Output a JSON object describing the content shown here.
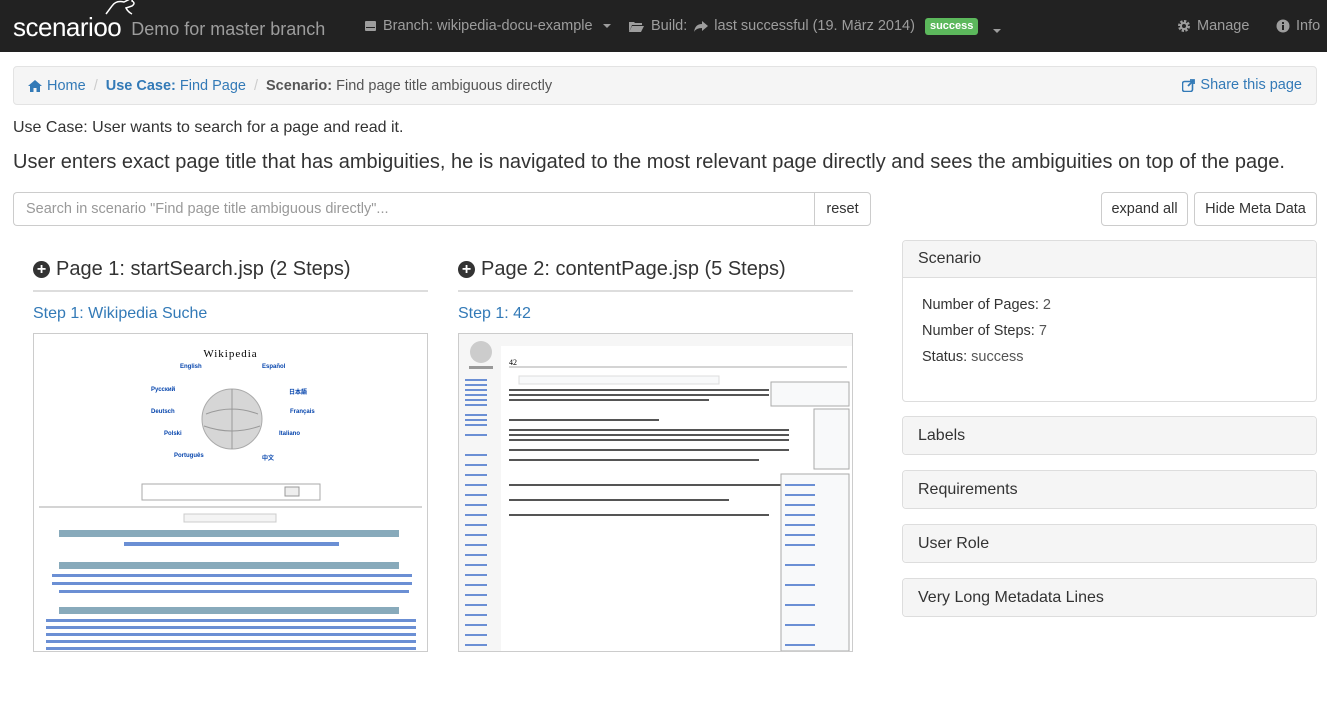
{
  "navbar": {
    "brand": "scenarioo",
    "title": "Demo for master branch",
    "branch_label": "Branch: wikipedia-docu-example",
    "build_label": "Build:",
    "build_value": "last successful (19. März 2014)",
    "build_status": "success",
    "manage": "Manage",
    "info": "Info"
  },
  "breadcrumb": {
    "home": "Home",
    "usecase_prefix": "Use Case:",
    "usecase": "Find Page",
    "scenario_prefix": "Scenario:",
    "scenario": "Find page title ambiguous directly",
    "share": "Share this page"
  },
  "usecase_description": "Use Case: User wants to search for a page and read it.",
  "scenario_description": "User enters exact page title that has ambiguities, he is navigated to the most relevant page directly and sees the ambiguities on top of the page.",
  "search": {
    "placeholder": "Search in scenario \"Find page title ambiguous directly\"...",
    "reset": "reset"
  },
  "buttons": {
    "expand_all": "expand all",
    "hide_meta": "Hide Meta Data"
  },
  "pages": [
    {
      "title": "Page 1: startSearch.jsp (2 Steps)",
      "step": "Step 1: Wikipedia Suche"
    },
    {
      "title": "Page 2: contentPage.jsp (5 Steps)",
      "step": "Step 1: 42"
    }
  ],
  "scenario_panel": {
    "heading": "Scenario",
    "pages_label": "Number of Pages:",
    "pages_value": "2",
    "steps_label": "Number of Steps:",
    "steps_value": "7",
    "status_label": "Status:",
    "status_value": "success"
  },
  "panels": [
    "Labels",
    "Requirements",
    "User Role",
    "Very Long Metadata Lines"
  ],
  "thumb1": {
    "logo": "Wikipedia",
    "languages": [
      "English",
      "Español",
      "Русский",
      "日本語",
      "Deutsch",
      "Français",
      "Polski",
      "Italiano",
      "Português",
      "中文"
    ]
  },
  "thumb2": {
    "title": "42"
  },
  "colors": {
    "navbar": "#222222",
    "link": "#337ab7",
    "success": "#5cb85c"
  }
}
